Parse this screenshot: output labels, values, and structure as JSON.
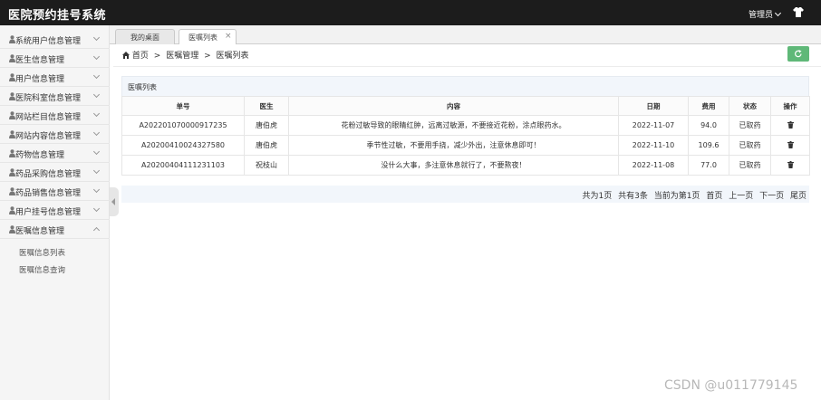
{
  "app": {
    "title": "医院预约挂号系统",
    "user_label": "管理员"
  },
  "sidebar": {
    "items": [
      {
        "label": "系统用户信息管理"
      },
      {
        "label": "医生信息管理"
      },
      {
        "label": "用户信息管理"
      },
      {
        "label": "医院科室信息管理"
      },
      {
        "label": "网站栏目信息管理"
      },
      {
        "label": "网站内容信息管理"
      },
      {
        "label": "药物信息管理"
      },
      {
        "label": "药品采购信息管理"
      },
      {
        "label": "药品销售信息管理"
      },
      {
        "label": "用户挂号信息管理"
      },
      {
        "label": "医嘱信息管理"
      }
    ],
    "submenu": [
      {
        "label": "医嘱信息列表"
      },
      {
        "label": "医嘱信息查询"
      }
    ]
  },
  "tabs": [
    {
      "label": "我的桌面"
    },
    {
      "label": "医嘱列表",
      "close": "×"
    }
  ],
  "breadcrumb": {
    "home": "首页",
    "sep1": ">",
    "level2": "医嘱管理",
    "sep2": ">",
    "current": "医嘱列表"
  },
  "panel": {
    "title": "医嘱列表"
  },
  "table": {
    "headers": [
      "单号",
      "医生",
      "内容",
      "日期",
      "费用",
      "状态",
      "操作"
    ],
    "rows": [
      {
        "id": "A202201070000917235",
        "doctor": "唐伯虎",
        "content": "花粉过敏导致的眼睛红肿，远离过敏源，不要接近花粉，涂点眼药水。",
        "date": "2022-11-07",
        "fee": "94.0",
        "status": "已取药"
      },
      {
        "id": "A20200410024327580",
        "doctor": "唐伯虎",
        "content": "季节性过敏，不要用手挠，减少外出，注意休息即可！",
        "date": "2022-11-10",
        "fee": "109.6",
        "status": "已取药"
      },
      {
        "id": "A20200404111231103",
        "doctor": "祝枝山",
        "content": "没什么大事，多注意休息就行了，不要熬夜！",
        "date": "2022-11-08",
        "fee": "77.0",
        "status": "已取药"
      }
    ]
  },
  "pager": {
    "total_pages": "共为1页",
    "total_items": "共有3条",
    "current": "当前为第1页",
    "first": "首页",
    "prev": "上一页",
    "next": "下一页",
    "last": "尾页"
  },
  "watermark": "CSDN @u011779145",
  "colors": {
    "topbar": "#1c1c1c",
    "refresh_button": "#5fb878",
    "panel_header": "#f2f6fb"
  }
}
